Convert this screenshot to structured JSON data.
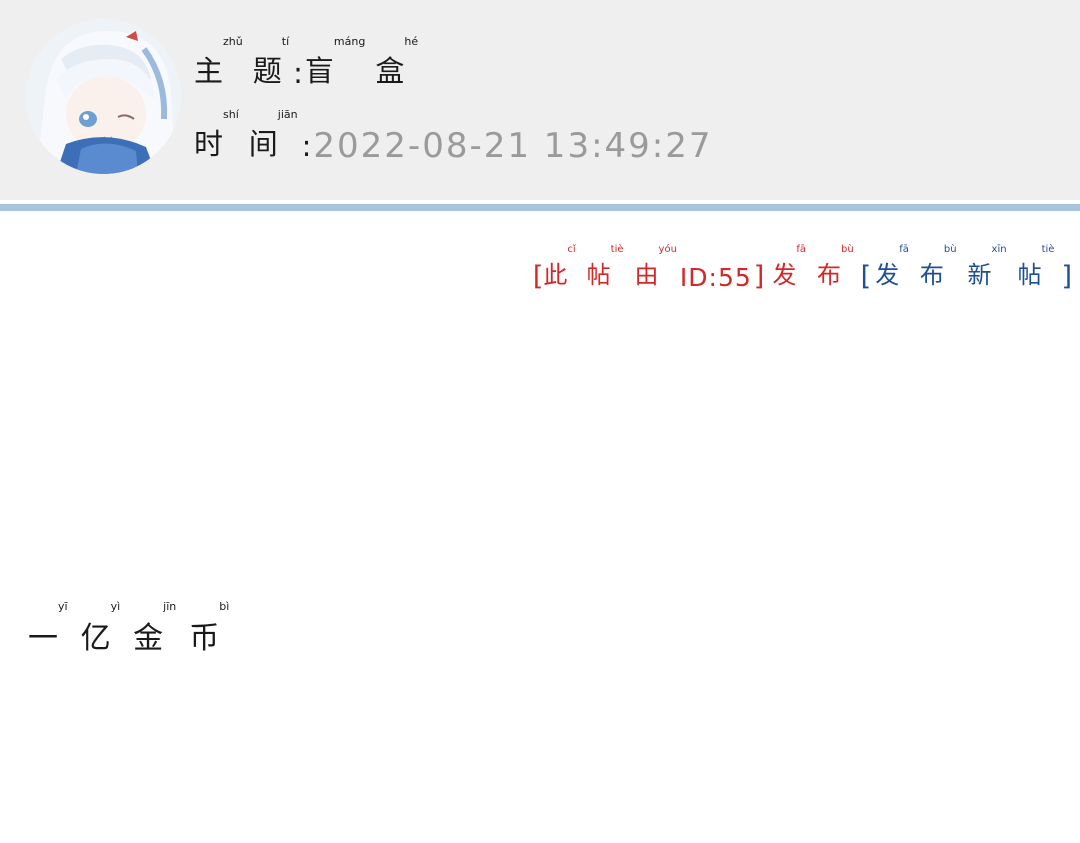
{
  "header": {
    "avatar_alt": "anime avatar",
    "topic": {
      "label": [
        {
          "char": "主",
          "pinyin": "zhǔ"
        },
        {
          "char": "题",
          "pinyin": "tí"
        }
      ],
      "colon": ":",
      "value": [
        {
          "char": "盲",
          "pinyin": "máng"
        },
        {
          "char": "盒",
          "pinyin": "hé"
        }
      ]
    },
    "time": {
      "label": [
        {
          "char": "时",
          "pinyin": "shí"
        },
        {
          "char": "间",
          "pinyin": "jiān"
        }
      ],
      "colon": ":",
      "value": "2022-08-21 13:49:27"
    }
  },
  "post_info": {
    "open_bracket": "[",
    "prefix": [
      {
        "char": "此",
        "pinyin": "cǐ"
      },
      {
        "char": "帖",
        "pinyin": "tiè"
      },
      {
        "char": "由",
        "pinyin": "yóu"
      }
    ],
    "user_id": "ID:55",
    "close_bracket": "]",
    "suffix": [
      {
        "char": "发",
        "pinyin": "fā"
      },
      {
        "char": "布",
        "pinyin": "bù"
      }
    ],
    "new_post": {
      "open_bracket": "[",
      "chars": [
        {
          "char": "发",
          "pinyin": "fā"
        },
        {
          "char": "布",
          "pinyin": "bù"
        },
        {
          "char": "新",
          "pinyin": "xīn"
        },
        {
          "char": "帖",
          "pinyin": "tiè"
        }
      ],
      "close_bracket": "]"
    }
  },
  "content": {
    "chars": [
      {
        "char": "一",
        "pinyin": "yī"
      },
      {
        "char": "亿",
        "pinyin": "yì"
      },
      {
        "char": "金",
        "pinyin": "jīn"
      },
      {
        "char": "币",
        "pinyin": "bì"
      }
    ]
  },
  "colors": {
    "header_bg": "#efefef",
    "divider": "#a7c3dd",
    "accent_red": "#d42828",
    "accent_blue": "#1f4f93",
    "time_gray": "#9a9a9a"
  }
}
